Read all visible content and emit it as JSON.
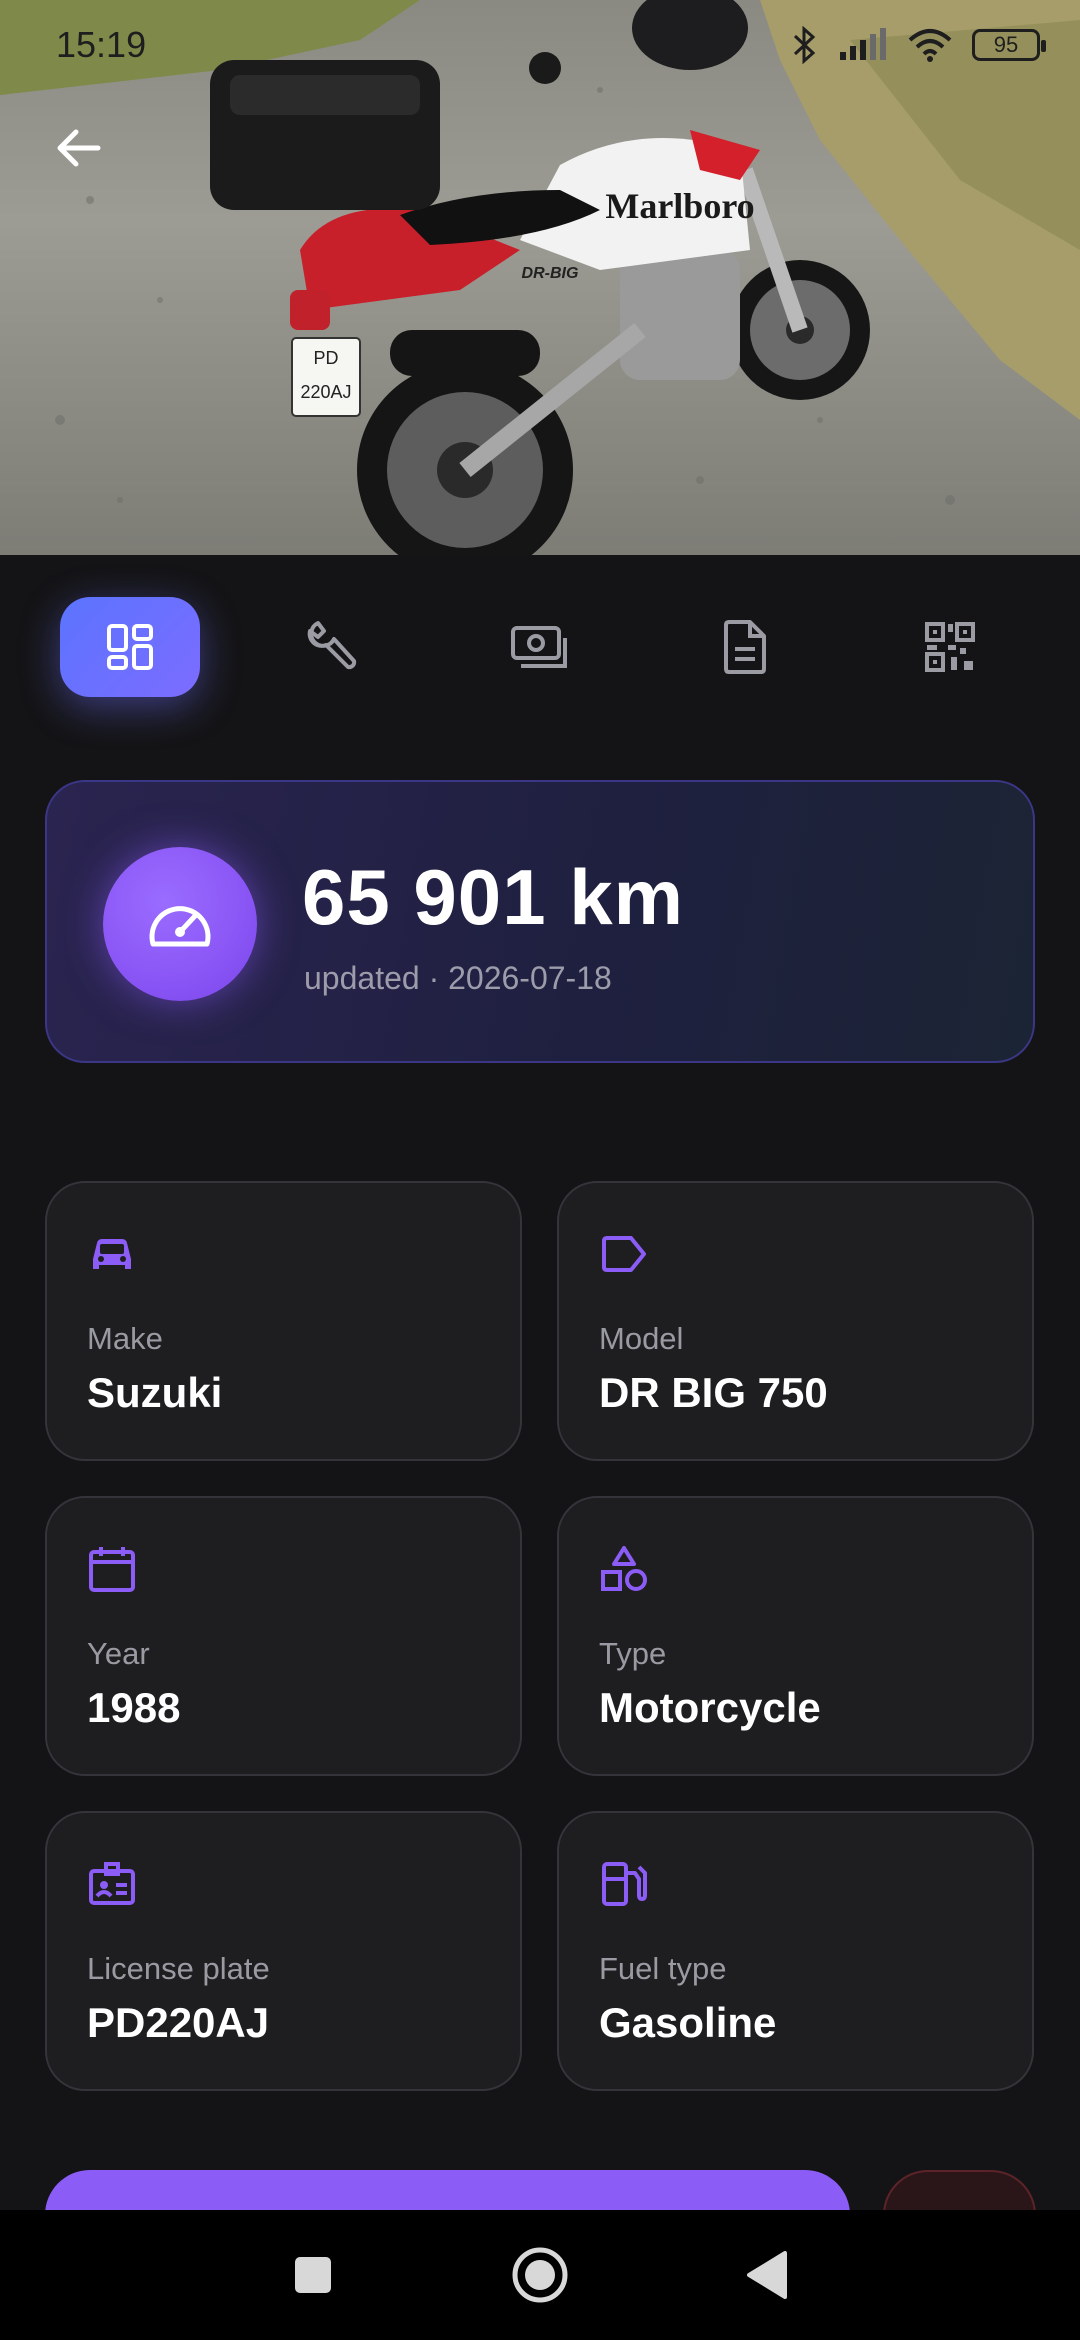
{
  "status_bar": {
    "time": "15:19",
    "battery": "95",
    "icons": [
      "bluetooth-icon",
      "signal-icon",
      "wifi-icon",
      "battery-icon"
    ]
  },
  "hero": {
    "plate_top": "PD",
    "plate_bottom": "220AJ",
    "tank_text": "Marlboro",
    "side_text": "DR-BIG",
    "back_icon": "arrow-left-icon"
  },
  "tabs": [
    {
      "name": "tab-overview",
      "icon": "dashboard-grid-icon",
      "active": true
    },
    {
      "name": "tab-maintenance",
      "icon": "wrench-icon",
      "active": false
    },
    {
      "name": "tab-expenses",
      "icon": "cash-icon",
      "active": false
    },
    {
      "name": "tab-documents",
      "icon": "document-icon",
      "active": false
    },
    {
      "name": "tab-qr",
      "icon": "qr-code-icon",
      "active": false
    }
  ],
  "odometer": {
    "value": "65 901 km",
    "updated": "updated · 2026-07-18",
    "icon": "speedometer-icon"
  },
  "details": {
    "make": {
      "label": "Make",
      "value": "Suzuki",
      "icon": "car-icon"
    },
    "model": {
      "label": "Model",
      "value": "DR BIG 750",
      "icon": "tag-icon"
    },
    "year": {
      "label": "Year",
      "value": "1988",
      "icon": "calendar-icon"
    },
    "type": {
      "label": "Type",
      "value": "Motorcycle",
      "icon": "shapes-icon"
    },
    "plate": {
      "label": "License plate",
      "value": "PD220AJ",
      "icon": "id-card-icon"
    },
    "fuel": {
      "label": "Fuel type",
      "value": "Gasoline",
      "icon": "fuel-pump-icon"
    }
  },
  "colors": {
    "accent": "#8b5cf6",
    "tab_active_start": "#5b74ff",
    "background": "#141416",
    "card": "#1e1e21",
    "danger_dark": "#2a1518"
  },
  "navbar": {
    "buttons": [
      "recents-square-icon",
      "home-circle-icon",
      "back-triangle-icon"
    ]
  }
}
